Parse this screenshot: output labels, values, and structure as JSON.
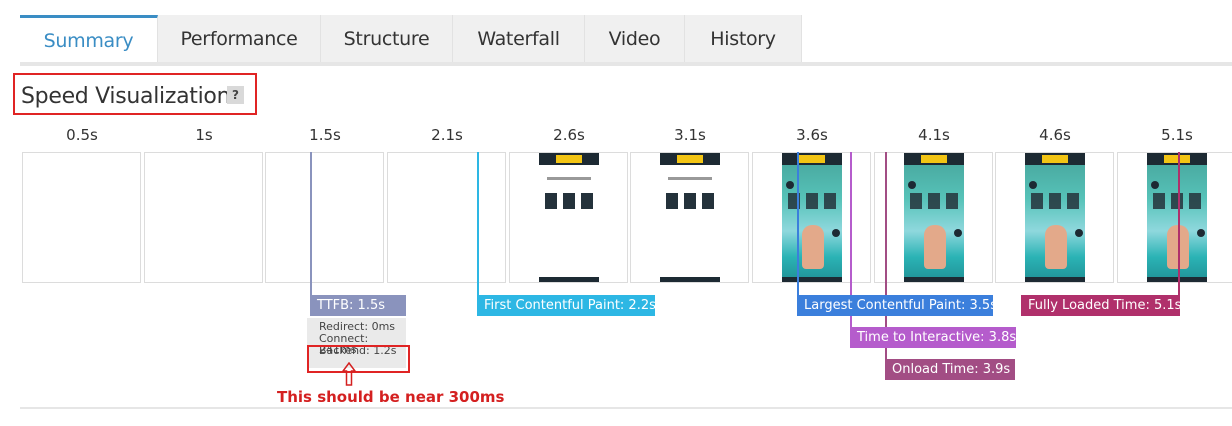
{
  "tabs": [
    {
      "label": "Summary",
      "active": true
    },
    {
      "label": "Performance",
      "active": false
    },
    {
      "label": "Structure",
      "active": false
    },
    {
      "label": "Waterfall",
      "active": false
    },
    {
      "label": "Video",
      "active": false
    },
    {
      "label": "History",
      "active": false
    }
  ],
  "section": {
    "title": "Speed Visualization",
    "help_label": "?"
  },
  "timeline": {
    "times": [
      "0.5s",
      "1s",
      "1.5s",
      "2.1s",
      "2.6s",
      "3.1s",
      "3.6s",
      "4.1s",
      "4.6s",
      "5.1s"
    ],
    "frame_states": [
      "blank",
      "blank",
      "blank",
      "blank",
      "text",
      "text",
      "hero",
      "hero",
      "hero",
      "hero"
    ]
  },
  "milestones": {
    "ttfb": {
      "label": "TTFB: 1.5s",
      "color": "#8a93bd"
    },
    "fcp": {
      "label": "First Contentful Paint: 2.2s",
      "color": "#2db7e4"
    },
    "lcp": {
      "label": "Largest Contentful Paint: 3.5s",
      "color": "#3b7fdc"
    },
    "fully_loaded": {
      "label": "Fully Loaded Time: 5.1s",
      "color": "#b0306b"
    },
    "tti": {
      "label": "Time to Interactive: 3.8s",
      "color": "#b55ccc"
    },
    "onload": {
      "label": "Onload Time: 3.9s",
      "color": "#a24d84"
    }
  },
  "ttfb_breakdown": {
    "redirect": "Redirect: 0ms",
    "connect": "Connect: 241ms",
    "backend": "Backend: 1.2s"
  },
  "annotation": {
    "text": "This should be near 300ms",
    "color": "#d42020",
    "arrow_icon": "⇧"
  },
  "colors": {
    "accent": "#3a8dc4",
    "highlight_box": "#e02424"
  }
}
